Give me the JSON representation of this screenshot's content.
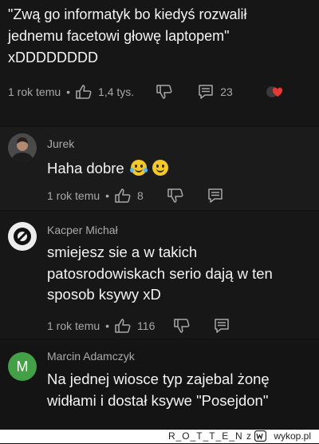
{
  "comments": [
    {
      "text_lines": [
        "\"Zwą go informatyk bo kiedyś rozwalił",
        "jednemu facetowi głowę laptopem\"",
        "xDDDDDDDD"
      ],
      "time": "1 rok temu",
      "likes": "1,4 tys.",
      "replies": "23"
    },
    {
      "author": "Jurek",
      "text_lines": [
        "Haha dobre"
      ],
      "time": "1 rok temu",
      "likes": "8"
    },
    {
      "author": "Kacper Michał",
      "text_lines": [
        "smiejesz sie a w takich",
        "patosrodowiskach serio dają w ten",
        "sposob ksywy xD"
      ],
      "time": "1 rok temu",
      "likes": "116"
    },
    {
      "author": "Marcin Adamczyk",
      "avatar_letter": "M",
      "avatar_color": "#43a047",
      "text_lines": [
        "Na jednej wiosce typ zajebal żonę",
        "widłami i dostał ksywe \"Posejdon\""
      ]
    }
  ],
  "watermark": {
    "user": "R_O_T_T_E_N z",
    "site": "wykop.pl"
  },
  "colors": {
    "background": "#121212",
    "text": "#f4f4f4",
    "meta": "#a8a8a8"
  }
}
